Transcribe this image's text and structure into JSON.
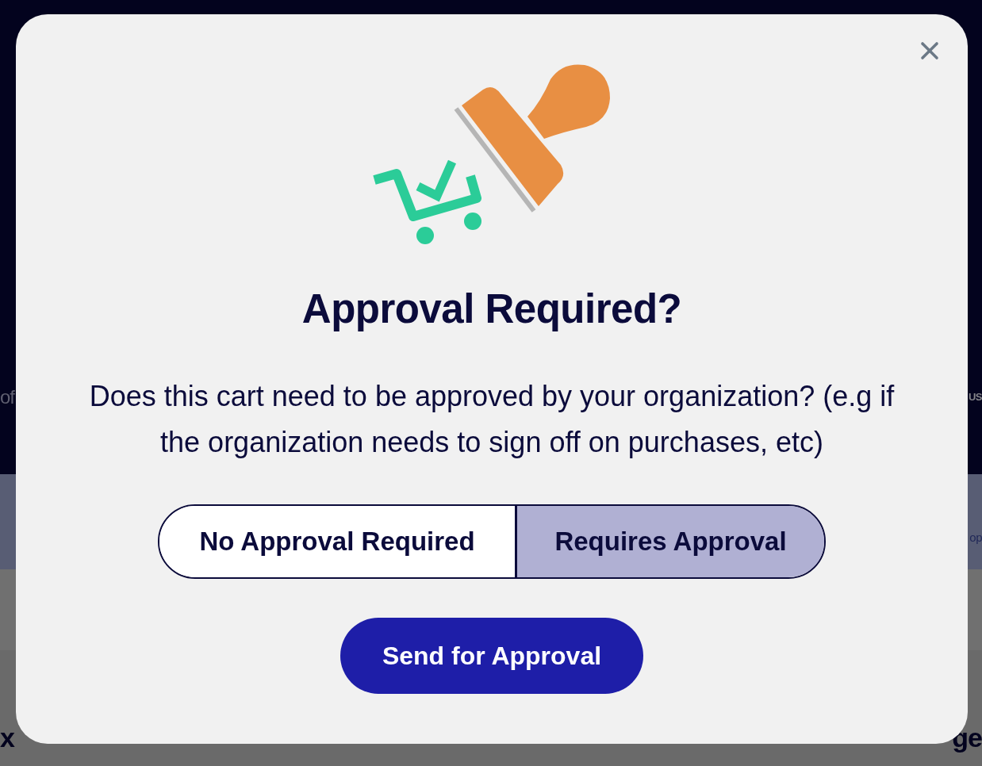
{
  "background": {
    "hero_left": "of",
    "hero_right": "US",
    "banner_right": "op",
    "product_title_left": "x",
    "product_title_right": "ge"
  },
  "dialog": {
    "title": "Approval Required?",
    "message": "Does this cart need to be approved by your organization? (e.g if the organization needs to sign off on purchases, etc)",
    "options": [
      {
        "label": "No Approval Required",
        "selected": false
      },
      {
        "label": "Requires Approval",
        "selected": true
      }
    ],
    "submit_button": "Send for Approval"
  }
}
